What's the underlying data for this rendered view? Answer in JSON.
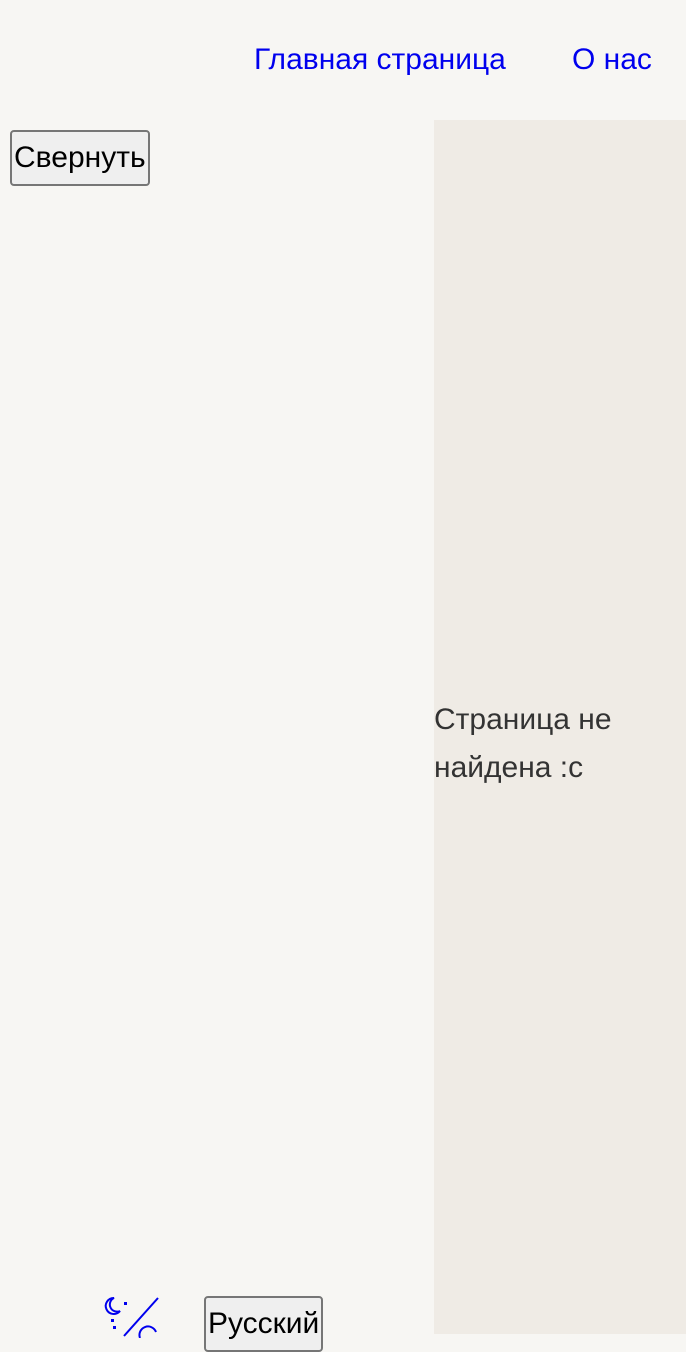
{
  "nav": {
    "links": [
      {
        "label": "Главная страница"
      },
      {
        "label": "О нас"
      }
    ],
    "link_color": "#0000ee"
  },
  "sidebar": {
    "collapse_label": "Свернуть",
    "theme_toggle_icon": "moon-sun-toggle-icon",
    "language_label": "Русский"
  },
  "main": {
    "message": "Страница не найдена :c"
  },
  "colors": {
    "background": "#f7f6f3",
    "content_background": "#efebe5",
    "text": "#333333"
  }
}
